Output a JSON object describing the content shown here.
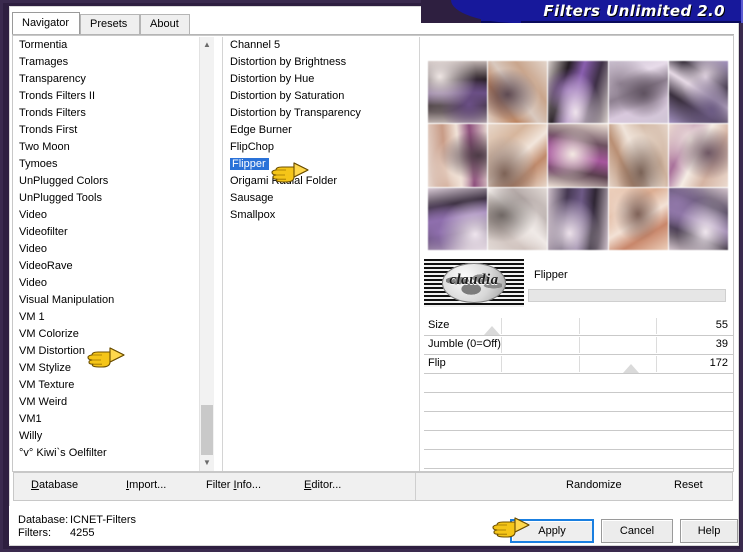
{
  "window": {
    "title": "Filters Unlimited 2.0"
  },
  "tabs": [
    {
      "label": "Navigator",
      "active": true
    },
    {
      "label": "Presets",
      "active": false
    },
    {
      "label": "About",
      "active": false
    }
  ],
  "categories": {
    "items": [
      "Tormentia",
      "Tramages",
      "Transparency",
      "Tronds Filters II",
      "Tronds Filters",
      "Tronds First",
      "Two Moon",
      "Tymoes",
      "UnPlugged Colors",
      "UnPlugged Tools",
      "Video",
      "Videofilter",
      "Video",
      "VideoRave",
      "Video",
      "Visual Manipulation",
      "VM 1",
      "VM Colorize",
      "VM Distortion",
      "VM Stylize",
      "VM Texture",
      "VM Weird",
      "VM1",
      "Willy",
      "°v° Kiwi`s Oelfilter"
    ],
    "selected": "VM Distortion"
  },
  "filters": {
    "items": [
      "Channel 5",
      "Distortion by Brightness",
      "Distortion by Hue",
      "Distortion by Saturation",
      "Distortion by Transparency",
      "Edge Burner",
      "FlipChop",
      "Flipper",
      "Origami Radial Folder",
      "Sausage",
      "Smallpox"
    ],
    "selected": "Flipper",
    "highlight_color": "#2a72d8"
  },
  "preview": {
    "filter_name": "Flipper",
    "logo_text": "claudia",
    "grid_rows": 3,
    "grid_cols": 5
  },
  "sliders": [
    {
      "label": "Size",
      "value": "55",
      "knob_pct": 22
    },
    {
      "label": "Jumble (0=Off)",
      "value": "39",
      "knob_pct": 0
    },
    {
      "label": "Flip",
      "value": "172",
      "knob_pct": 67
    }
  ],
  "toolbar": {
    "database_label": "Database",
    "import_label": "Import...",
    "filter_info_label": "Filter Info...",
    "editor_label": "Editor...",
    "randomize_label": "Randomize",
    "reset_label": "Reset"
  },
  "status": {
    "database_key": "Database:",
    "database_value": "ICNET-Filters",
    "filters_key": "Filters:",
    "filters_value": "4255"
  },
  "buttons": {
    "apply_label": "Apply",
    "cancel_label": "Cancel",
    "help_label": "Help"
  },
  "icons": {
    "scroll_up": "▲",
    "scroll_down": "▼"
  },
  "colors": {
    "title_bar": "#17189b",
    "selection": "#2a72d8",
    "focus_ring": "#1a7fe0",
    "frame": "#2e1f40"
  }
}
